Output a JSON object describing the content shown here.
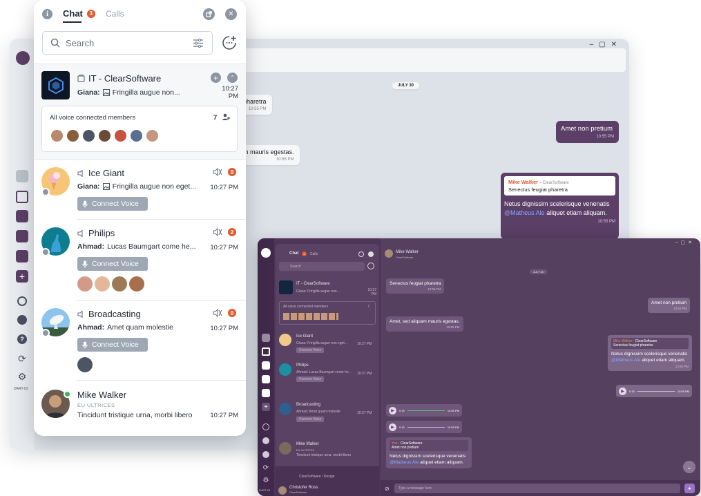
{
  "panel": {
    "tabs": [
      {
        "label": "Chat",
        "badge": "3"
      },
      {
        "label": "Calls"
      }
    ],
    "search_placeholder": "Search",
    "pinned": {
      "name": "IT - ClearSoftware",
      "preview_sender": "Giana:",
      "preview_text": "Fringilla augue non...",
      "time": "10:27 PM",
      "voice_members_label": "All voice connected members",
      "voice_members_count": "7"
    },
    "chats": [
      {
        "name": "Ice Giant",
        "sender": "Giana:",
        "text": "Fringilla augue non eget...",
        "time": "10:27 PM",
        "badge": "0",
        "button": "Connect Voice"
      },
      {
        "name": "Philips",
        "sender": "Ahmad:",
        "text": "Lucas Baumgart come he...",
        "time": "10:27 PM",
        "badge": "2",
        "button": "Connect Voice"
      },
      {
        "name": "Broadcasting",
        "sender": "Ahmad:",
        "text": "Amet quam molestie",
        "time": "10:27 PM",
        "badge": "0",
        "button": "Connect Voice"
      },
      {
        "name": "Mike Walker",
        "subtitle": "EU ULTRICES",
        "text": "Tincidunt tristique urna, morbi libero",
        "time": "10:27 PM"
      }
    ]
  },
  "bg": {
    "date": "JULY 30",
    "messages": [
      {
        "text": "pharetra",
        "time": "10:55 PM"
      },
      {
        "text": "Amet non pretium",
        "time": "10:55 PM"
      },
      {
        "text": "m mauris egestas.",
        "time": "10:55 PM"
      }
    ],
    "reply": {
      "author": "Mike Walker",
      "org": "ClearSoftware",
      "quote": "Senectus feugiat pharetra",
      "body_a": "Netus dignissim scelerisque venenatis",
      "mention": "@Matheus Ale",
      "body_b": "aliquet etiam aliquam.",
      "time": "10:55 PM"
    },
    "side_label": "DART-03"
  },
  "dark": {
    "header_name": "Mike Walker",
    "header_sub": "ClearSoftware",
    "date": "JULY 30",
    "tabs": [
      "Chat",
      "Calls"
    ],
    "tab_badge": "3",
    "search": "Search",
    "pinned": {
      "name": "IT - ClearSoftware",
      "preview": "Giana: Fringilla augue non...",
      "time": "10:27 PM",
      "voice_label": "All voice connected members",
      "count": "7"
    },
    "items": [
      {
        "name": "Ice Giant",
        "preview": "Giana: Fringilla augue non eget...",
        "time": "10:27 PM",
        "button": "Connect Voice"
      },
      {
        "name": "Philips",
        "preview": "Ahmad: Lucas Baumgart come he...",
        "time": "10:27 PM",
        "button": "Connect Voice"
      },
      {
        "name": "Broadcasting",
        "preview": "Ahmad: Amet quam molestie",
        "time": "10:27 PM",
        "button": "Connect Voice"
      },
      {
        "name": "Mike Walker",
        "sub": "EU ULTRICES",
        "preview": "Tincidunt tristique urna, morbi libero",
        "time": "10:27 PM"
      }
    ],
    "bottom_channel": "ClearSoftware / Design",
    "user_name": "Christofer Ross",
    "user_sub": "ClearSoftware",
    "rail_label": "DART-03",
    "messages": {
      "m1": {
        "text": "Senectus feugiat pharetra",
        "time": "10:55 PM"
      },
      "m2": {
        "text": "Amet non pretium",
        "time": "10:55 PM"
      },
      "m3": {
        "text": "Amet, sed aliquam mauris egestas.",
        "time": "10:55 PM"
      },
      "reply_author": "Mike Walker",
      "reply_org": "ClearSoftware",
      "reply_quote": "Senectus feugiat pharetra",
      "reply_body_a": "Netus dignissim scelerisque venenatis",
      "reply_mention": "@Matheus Ale",
      "reply_body_b": "aliquet etiam aliquam.",
      "reply_time": "10:55 PM",
      "audio_time": "10:55 PM",
      "audio_dur": "0:15",
      "reply2_author": "You",
      "reply2_org": "ClearSoftware",
      "reply2_quote": "Amet non pretium",
      "reply2_body_a": "Netus dignissim scelerisque venenatis",
      "reply2_mention": "@Matheus Ale",
      "reply2_body_b": "aliquet etiam aliquam."
    },
    "composer_placeholder": "Type a message here"
  },
  "colors": {
    "accent": "#e05a2d",
    "brand_purple": "#5b3f66",
    "button_gray": "#9ea8b5",
    "online": "#3cb55b"
  }
}
